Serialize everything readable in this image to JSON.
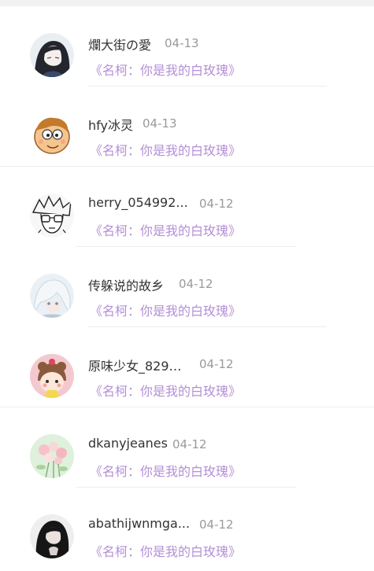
{
  "comments": [
    {
      "username": "爛大街の愛",
      "date": "04-13",
      "quote": "《名柯：你是我的白玫瑰》",
      "avatar_icon": "anime-girl-avatar-icon"
    },
    {
      "username": "hfy冰灵",
      "date": "04-13",
      "quote": "《名柯：你是我的白玫瑰》",
      "avatar_icon": "cartoon-boy-avatar-icon"
    },
    {
      "username": "herry_054992...",
      "date": "04-12",
      "quote": "《名柯：你是我的白玫瑰》",
      "avatar_icon": "sketch-glasses-avatar-icon"
    },
    {
      "username": "传躲说的故乡",
      "date": "04-12",
      "quote": "《名柯：你是我的白玫瑰》",
      "avatar_icon": "white-hair-avatar-icon"
    },
    {
      "username": "原味少女_829…",
      "date": "04-12",
      "quote": "《名柯：你是我的白玫瑰》",
      "avatar_icon": "bear-girl-avatar-icon"
    },
    {
      "username": "dkanyjeanes",
      "date": "04-12",
      "quote": "《名柯：你是我的白玫瑰》",
      "avatar_icon": "flowers-avatar-icon"
    },
    {
      "username": "abathijwnmga...",
      "date": "04-12",
      "quote": "《名柯：你是我的白玫瑰》",
      "avatar_icon": "dark-hair-avatar-icon"
    }
  ],
  "colors": {
    "username": "#333333",
    "date": "#9a9a9a",
    "quote": "#b48fd6",
    "divider": "#eeeeee"
  }
}
